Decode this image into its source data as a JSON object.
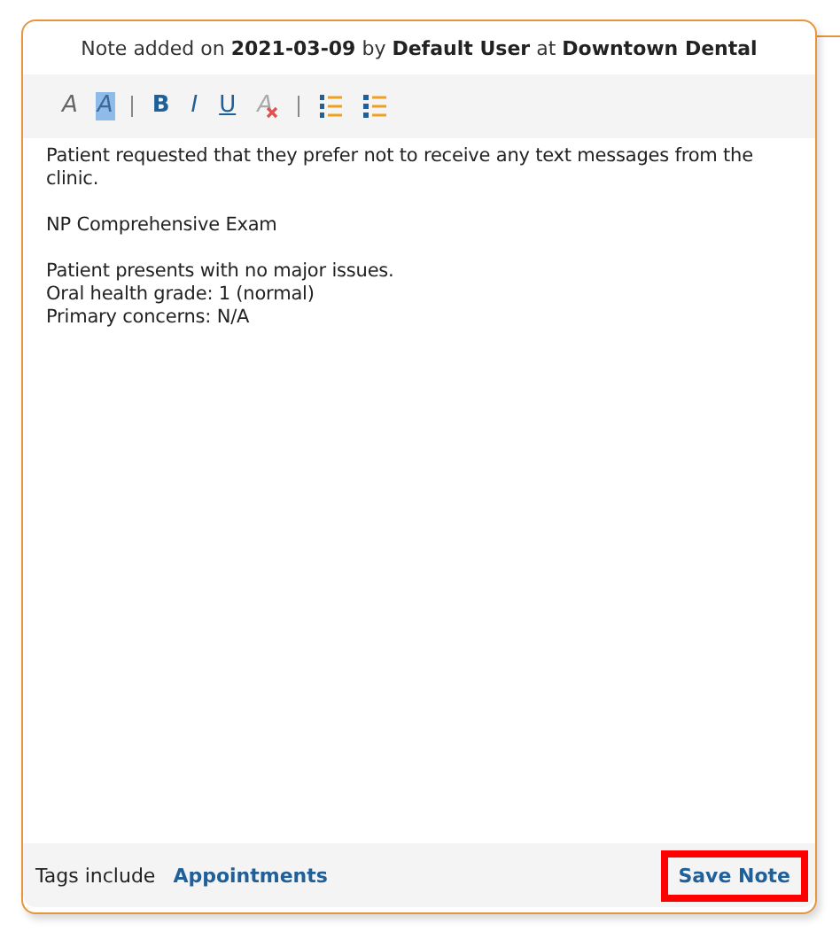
{
  "note_header": "Note added on **2021-03-09** by **Default User** at **Downtown Dental**",
  "toolbar": [
    {
      "kind": "font-color",
      "label": "A"
    },
    {
      "kind": "highlight",
      "label": "A"
    },
    {
      "kind": "separator"
    },
    {
      "kind": "bold",
      "label": "B"
    },
    {
      "kind": "italic",
      "label": "I"
    },
    {
      "kind": "underline",
      "label": "U"
    },
    {
      "kind": "clear-format",
      "label": "A"
    },
    {
      "kind": "separator"
    },
    {
      "kind": "numbered-list"
    },
    {
      "kind": "bullet-list"
    }
  ],
  "editor": {
    "paragraphs": [
      [
        "Patient requested that they prefer not to receive any text messages from the clinic."
      ],
      [
        "NP Comprehensive Exam"
      ],
      [
        "Patient presents with no major issues.",
        "Oral health grade: 1 (normal)",
        "Primary concerns: N/A"
      ]
    ]
  },
  "footer": {
    "tags_label": "Tags include",
    "tags": [
      "Appointments"
    ],
    "save_button": {
      "label": "Save Note",
      "highlighted": true
    }
  }
}
